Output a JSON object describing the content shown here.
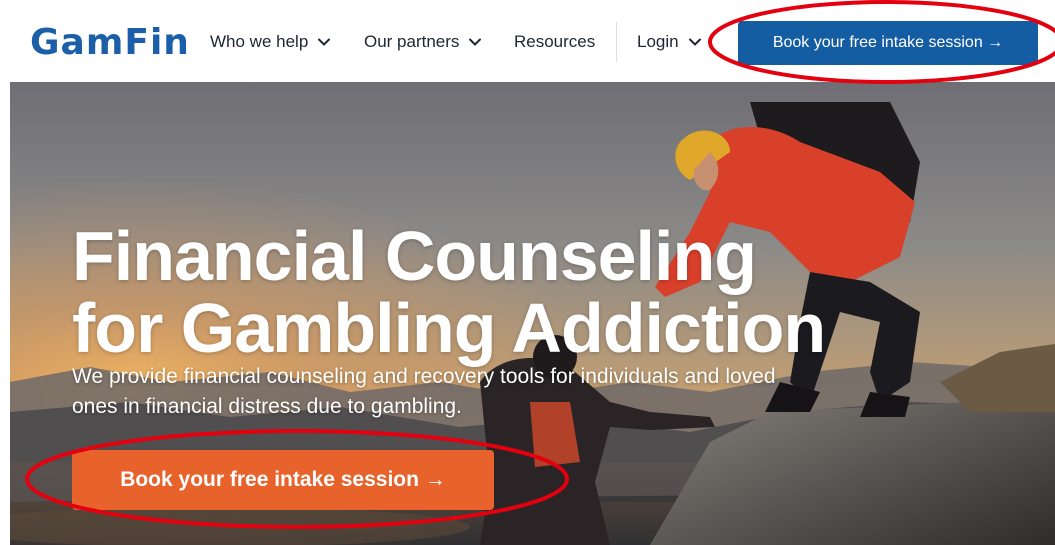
{
  "brand": {
    "logo_text": "GamFin",
    "primary_color": "#155da3",
    "accent_color": "#e8622c"
  },
  "nav": {
    "items": [
      {
        "label": "Who we help",
        "has_dropdown": true
      },
      {
        "label": "Our partners",
        "has_dropdown": true
      },
      {
        "label": "Resources",
        "has_dropdown": false
      },
      {
        "label": "Login",
        "has_dropdown": true
      }
    ],
    "cta_label": "Book your free intake session →"
  },
  "hero": {
    "title": "Financial Counseling\nfor Gambling Addiction",
    "subtitle": "We provide financial counseling and recovery tools for individuals and loved ones in financial distress due to gambling.",
    "cta_label": "Book your free intake session →",
    "background": "photo-hikers-helping-hand-on-mountain-at-sunset"
  },
  "annotations": {
    "highlight_color": "#e3000f"
  }
}
